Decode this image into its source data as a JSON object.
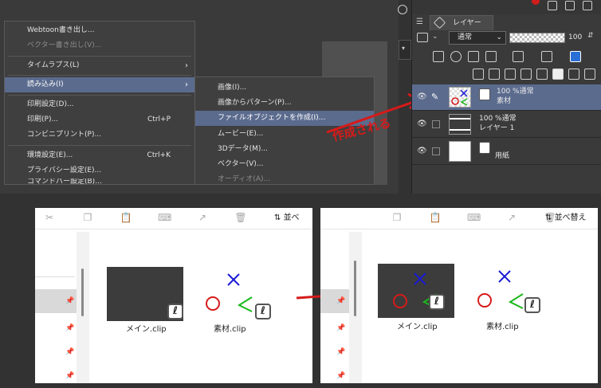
{
  "main_menu": {
    "items": [
      {
        "label": "Webtoon書き出し...",
        "disabled": false
      },
      {
        "label": "ベクター書き出し(V)...",
        "disabled": true
      },
      {
        "label": "タイムラプス(L)",
        "disabled": false
      },
      {
        "label": "読み込み(I)",
        "disabled": false
      },
      {
        "label": "印刷設定(D)...",
        "disabled": false
      },
      {
        "label": "印刷(P)...",
        "shortcut": "Ctrl+P",
        "disabled": false
      },
      {
        "label": "コンビニプリント(P)...",
        "disabled": false
      },
      {
        "label": "環境設定(E)...",
        "shortcut": "Ctrl+K",
        "disabled": false
      },
      {
        "label": "プライバシー設定(E)...",
        "disabled": false
      },
      {
        "label": "コマンドバー設定(B)...",
        "disabled": false
      }
    ]
  },
  "import_submenu": {
    "items": [
      {
        "label": "画像(I)...",
        "disabled": false
      },
      {
        "label": "画像からパターン(P)...",
        "disabled": false
      },
      {
        "label": "ファイルオブジェクトを作成(I)...",
        "disabled": false
      },
      {
        "label": "ムービー(E)...",
        "disabled": false
      },
      {
        "label": "3Dデータ(M)...",
        "disabled": false
      },
      {
        "label": "ベクター(V)...",
        "disabled": false
      },
      {
        "label": "オーディオ(A)...",
        "disabled": true
      }
    ]
  },
  "annotation_top": "作成される",
  "layer_panel": {
    "tab_label": "レイヤー",
    "blend_mode": "通常",
    "opacity": "100",
    "layers": [
      {
        "line1": "100 %通常",
        "line2": "素材",
        "selected": true
      },
      {
        "line1": "100 %通常",
        "line2": "レイヤー 1",
        "selected": false
      },
      {
        "line1": "",
        "line2": "用紙",
        "selected": false
      }
    ]
  },
  "explorer_before": {
    "sort_label": "並べ",
    "files": [
      {
        "name": "メイン.clip",
        "icon": "clip-studio-icon"
      },
      {
        "name": "素材.clip",
        "icon": "clip-studio-icon"
      }
    ]
  },
  "explorer_after": {
    "sort_label": "並べ替え",
    "files": [
      {
        "name": "メイン.clip",
        "icon": "clip-studio-icon"
      },
      {
        "name": "素材.clip",
        "icon": "clip-studio-icon"
      }
    ]
  },
  "colors": {
    "menu_highlight": "#5b6b8e",
    "annotation_red": "#d61a1a",
    "sketch_blue": "#1a1ad6",
    "sketch_green": "#1ab81a"
  }
}
